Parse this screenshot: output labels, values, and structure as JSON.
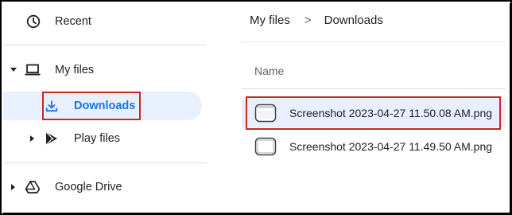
{
  "sidebar": {
    "recent": {
      "label": "Recent",
      "icon": "clock-icon"
    },
    "my_files": {
      "label": "My files",
      "icon": "laptop-icon",
      "expanded": true
    },
    "downloads": {
      "label": "Downloads",
      "icon": "download-icon",
      "selected": true
    },
    "play_files": {
      "label": "Play files",
      "icon": "play-store-icon"
    },
    "google_drive": {
      "label": "Google Drive",
      "icon": "google-drive-icon"
    }
  },
  "breadcrumb": {
    "root": "My files",
    "separator": ">",
    "current": "Downloads"
  },
  "file_list": {
    "column_name": "Name",
    "files": [
      {
        "name": "Screenshot 2023-04-27 11.50.08 AM.png",
        "selected": true
      },
      {
        "name": "Screenshot 2023-04-27 11.49.50 AM.png",
        "selected": false
      }
    ]
  },
  "colors": {
    "selection_bg": "#e8f0fe",
    "accent_blue": "#1a73e8",
    "highlight_red": "#c62828"
  }
}
